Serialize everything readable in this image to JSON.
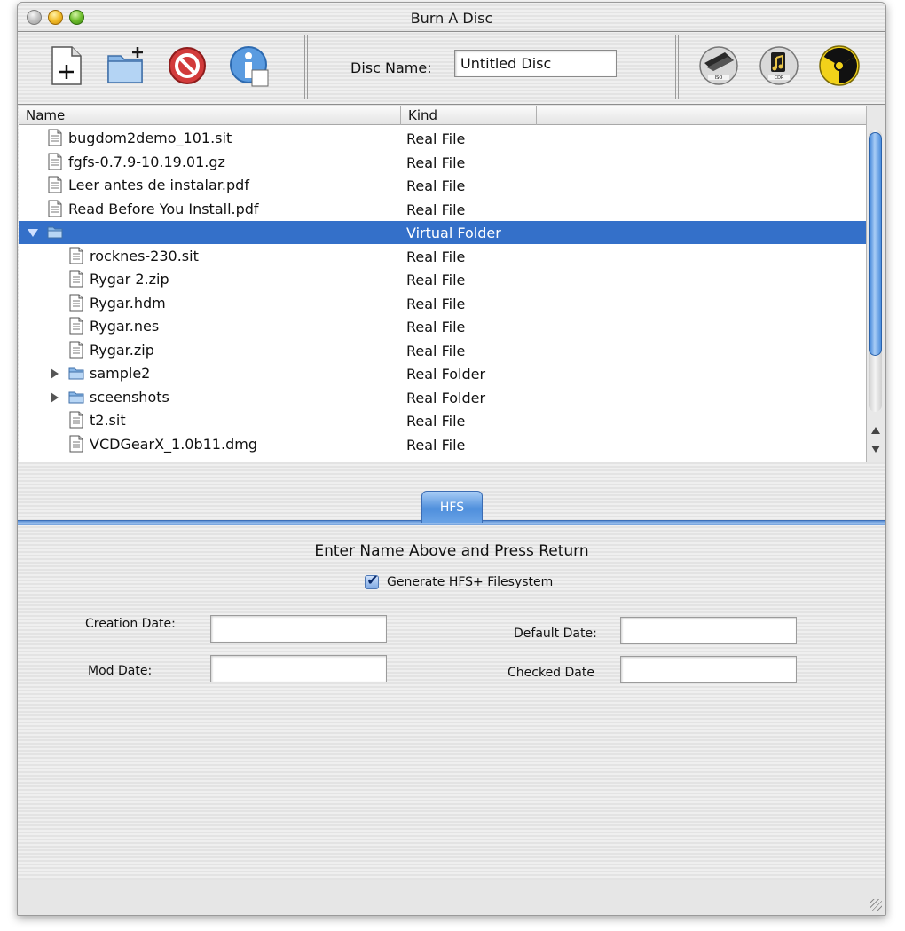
{
  "window": {
    "title": "Burn A Disc"
  },
  "toolbar": {
    "disc_name_label": "Disc Name:",
    "disc_name_value": "Untitled Disc",
    "left_tools": [
      "new-file-icon",
      "new-folder-icon",
      "delete-icon",
      "info-icon"
    ],
    "right_tools": [
      "iso-image-icon",
      "cdr-audio-icon",
      "burn-icon"
    ]
  },
  "file_list": {
    "columns": [
      "Name",
      "Kind"
    ],
    "rows": [
      {
        "name": "bugdom2demo_101.sit",
        "kind": "Real File",
        "type": "file",
        "depth": 0
      },
      {
        "name": "fgfs-0.7.9-10.19.01.gz",
        "kind": "Real File",
        "type": "file",
        "depth": 0
      },
      {
        "name": "Leer antes de instalar.pdf",
        "kind": "Real File",
        "type": "file",
        "depth": 0
      },
      {
        "name": "Read Before You Install.pdf",
        "kind": "Real File",
        "type": "file",
        "depth": 0
      },
      {
        "name": "",
        "kind": "Virtual Folder",
        "type": "folder",
        "depth": 0,
        "expanded": true,
        "selected": true
      },
      {
        "name": "rocknes-230.sit",
        "kind": "Real File",
        "type": "file",
        "depth": 1
      },
      {
        "name": "Rygar 2.zip",
        "kind": "Real File",
        "type": "file",
        "depth": 1
      },
      {
        "name": "Rygar.hdm",
        "kind": "Real File",
        "type": "file",
        "depth": 1
      },
      {
        "name": "Rygar.nes",
        "kind": "Real File",
        "type": "file",
        "depth": 1
      },
      {
        "name": "Rygar.zip",
        "kind": "Real File",
        "type": "file",
        "depth": 1
      },
      {
        "name": "sample2",
        "kind": "Real Folder",
        "type": "folder",
        "depth": 1,
        "expanded": false
      },
      {
        "name": "sceenshots",
        "kind": "Real Folder",
        "type": "folder",
        "depth": 1,
        "expanded": false
      },
      {
        "name": "t2.sit",
        "kind": "Real File",
        "type": "file",
        "depth": 1
      },
      {
        "name": "VCDGearX_1.0b11.dmg",
        "kind": "Real File",
        "type": "file",
        "depth": 1
      }
    ]
  },
  "tabs": {
    "hfs": "HFS"
  },
  "hfs_panel": {
    "heading": "Enter Name Above and Press Return",
    "generate_label": "Generate HFS+ Filesystem",
    "generate_checked": true,
    "creation_date_label": "Creation Date:",
    "mod_date_label": "Mod Date:",
    "default_date_label": "Default Date:",
    "checked_date_label": "Checked Date",
    "creation_date_value": "",
    "mod_date_value": "",
    "default_date_value": "",
    "checked_date_value": ""
  },
  "colors": {
    "selection": "#3470c9",
    "tab_accent": "#4f8fdc"
  }
}
